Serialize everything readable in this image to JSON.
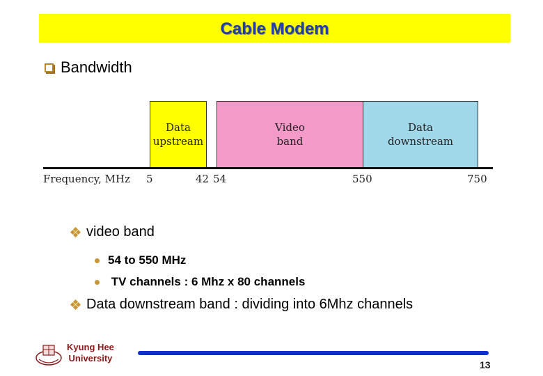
{
  "slide": {
    "title": "Cable Modem",
    "section_heading": "Bandwidth",
    "colors": {
      "title_background": "#ffff00",
      "title_text": "#1f3fa8",
      "bullet_accent": "#c8963a",
      "footer_bar": "#1030d0",
      "footer_text": "#8b1a1a"
    }
  },
  "diagram": {
    "axis_label": "Frequency, MHz",
    "ticks": [
      "5",
      "42",
      "54",
      "550",
      "750"
    ],
    "bands": [
      {
        "label": "Data\nupstream",
        "from_mhz": 5,
        "to_mhz": 42,
        "color": "#ffff00"
      },
      {
        "label": "Video\nband",
        "from_mhz": 54,
        "to_mhz": 550,
        "color": "#f49ac8"
      },
      {
        "label": "Data\ndownstream",
        "from_mhz": 550,
        "to_mhz": 750,
        "color": "#a0d8ea"
      }
    ]
  },
  "bullets": [
    {
      "text": "video band",
      "sub": [
        "54 to 550 MHz",
        " TV channels : 6 Mhz x 80 channels"
      ]
    },
    {
      "text": "Data downstream band : dividing into 6Mhz channels",
      "sub": []
    }
  ],
  "footer": {
    "university_line1": "Kyung Hee",
    "university_line2": "University",
    "page_number": "13"
  }
}
